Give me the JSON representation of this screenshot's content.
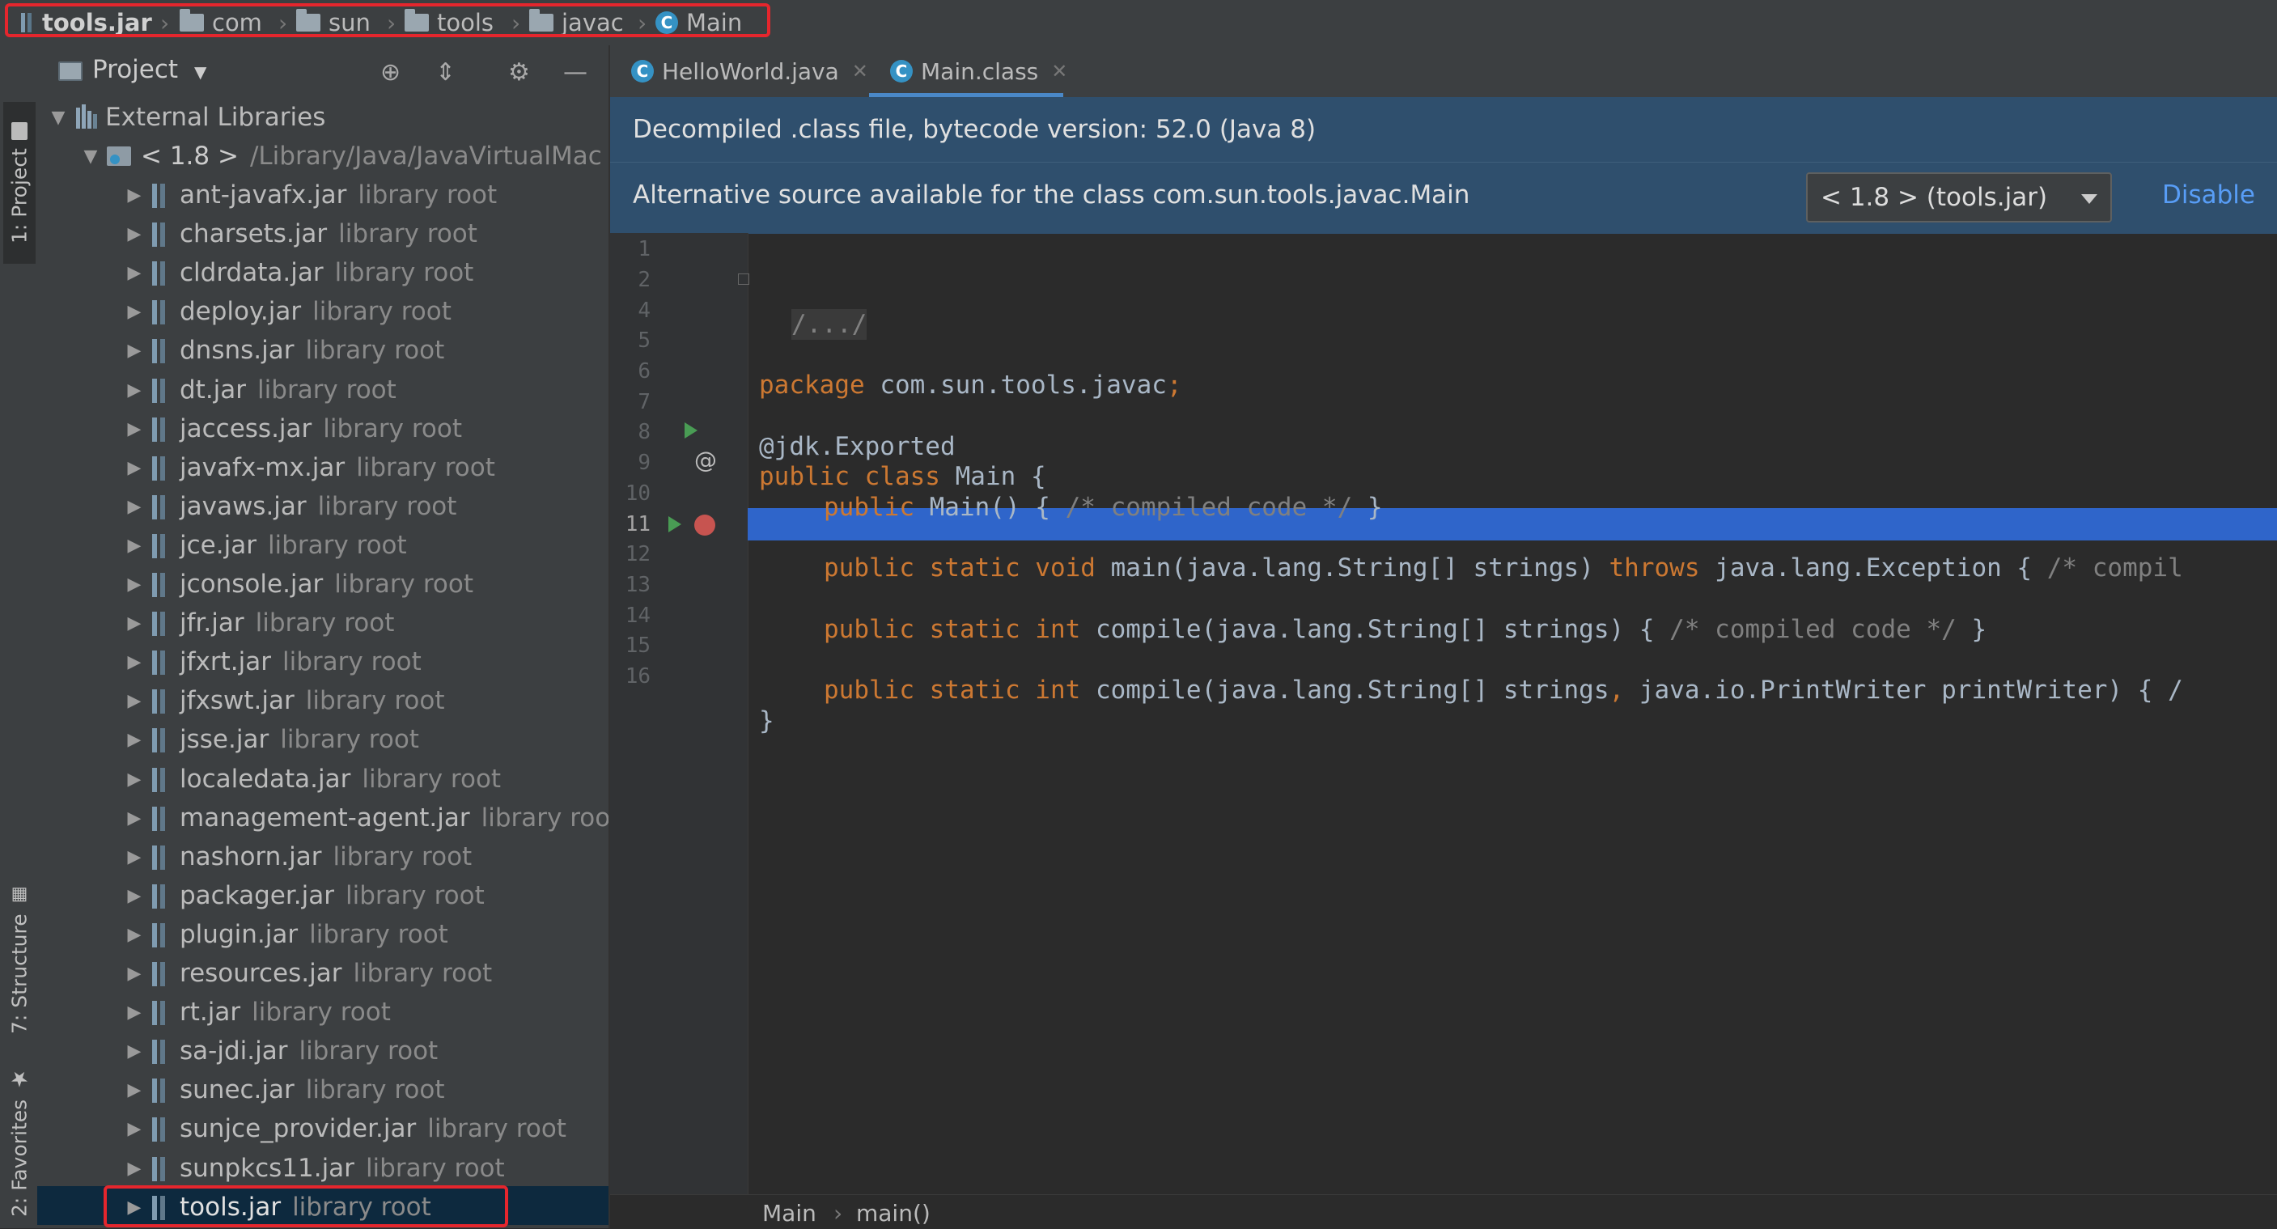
{
  "breadcrumb": [
    {
      "label": "tools.jar",
      "icon": "jar-icon"
    },
    {
      "label": "com",
      "icon": "folder-icon"
    },
    {
      "label": "sun",
      "icon": "folder-icon"
    },
    {
      "label": "tools",
      "icon": "folder-icon"
    },
    {
      "label": "javac",
      "icon": "folder-icon"
    },
    {
      "label": "Main",
      "icon": "class-icon"
    }
  ],
  "tool_stripe": {
    "project": "1: Project",
    "structure": "7: Structure",
    "favorites": "2: Favorites"
  },
  "project_panel": {
    "title": "Project",
    "external_libraries": "External Libraries",
    "jdk_name": "< 1.8 >",
    "jdk_path": "/Library/Java/JavaVirtualMac",
    "jars": [
      {
        "name": "ant-javafx.jar",
        "ann": "library root"
      },
      {
        "name": "charsets.jar",
        "ann": "library root"
      },
      {
        "name": "cldrdata.jar",
        "ann": "library root"
      },
      {
        "name": "deploy.jar",
        "ann": "library root"
      },
      {
        "name": "dnsns.jar",
        "ann": "library root"
      },
      {
        "name": "dt.jar",
        "ann": "library root"
      },
      {
        "name": "jaccess.jar",
        "ann": "library root"
      },
      {
        "name": "javafx-mx.jar",
        "ann": "library root"
      },
      {
        "name": "javaws.jar",
        "ann": "library root"
      },
      {
        "name": "jce.jar",
        "ann": "library root"
      },
      {
        "name": "jconsole.jar",
        "ann": "library root"
      },
      {
        "name": "jfr.jar",
        "ann": "library root"
      },
      {
        "name": "jfxrt.jar",
        "ann": "library root"
      },
      {
        "name": "jfxswt.jar",
        "ann": "library root"
      },
      {
        "name": "jsse.jar",
        "ann": "library root"
      },
      {
        "name": "localedata.jar",
        "ann": "library root"
      },
      {
        "name": "management-agent.jar",
        "ann": "library roo"
      },
      {
        "name": "nashorn.jar",
        "ann": "library root"
      },
      {
        "name": "packager.jar",
        "ann": "library root"
      },
      {
        "name": "plugin.jar",
        "ann": "library root"
      },
      {
        "name": "resources.jar",
        "ann": "library root"
      },
      {
        "name": "rt.jar",
        "ann": "library root"
      },
      {
        "name": "sa-jdi.jar",
        "ann": "library root"
      },
      {
        "name": "sunec.jar",
        "ann": "library root"
      },
      {
        "name": "sunjce_provider.jar",
        "ann": "library root"
      },
      {
        "name": "sunpkcs11.jar",
        "ann": "library root"
      },
      {
        "name": "tools.jar",
        "ann": "library root"
      }
    ]
  },
  "editor": {
    "tabs": [
      {
        "label": "HelloWorld.java",
        "active": false
      },
      {
        "label": "Main.class",
        "active": true
      }
    ],
    "banner_decompiled": "Decompiled .class file, bytecode version: 52.0 (Java 8)",
    "banner_alt_source": "Alternative source available for the class com.sun.tools.javac.Main",
    "sdk_select_value": "< 1.8 > (tools.jar)",
    "disable_label": "Disable",
    "line_numbers": [
      "1",
      "2",
      "4",
      "5",
      "6",
      "7",
      "8",
      "9",
      "10",
      "11",
      "12",
      "13",
      "14",
      "15",
      "16"
    ],
    "code": {
      "l2": "/.../",
      "l5_kw": "package",
      "l5_rest": " com.sun.tools.javac",
      "l5_semi": ";",
      "l7": "@jdk.Exported",
      "l8_kw": "public class",
      "l8_rest": " Main {",
      "l9_kw": "public",
      "l9_rest": " Main() { ",
      "l9_cm": "/* compiled code */",
      "l9_end": " }",
      "l11_kw": "public static void",
      "l11_rest": " main(java.lang.String[] strings) ",
      "l11_kw2": "throws",
      "l11_rest2": " java.lang.Exception { ",
      "l11_cm": "/* compil",
      "l13_kw": "public static int",
      "l13_rest": " compile(java.lang.String[] strings) { ",
      "l13_cm": "/* compiled code */",
      "l13_end": " }",
      "l15_kw": "public static int",
      "l15_rest": " compile(java.lang.String[] strings",
      "l15_comma": ",",
      "l15_rest2": " java.io.PrintWriter printWriter) { /",
      "l16": "}"
    },
    "status_breadcrumb": [
      "Main",
      "main()"
    ]
  },
  "colors": {
    "highlight_outline": "#e5262d",
    "selection_line": "#2f65ca",
    "keyword": "#cc7832",
    "banner_bg": "#2f4f6d",
    "link": "#589df6"
  }
}
